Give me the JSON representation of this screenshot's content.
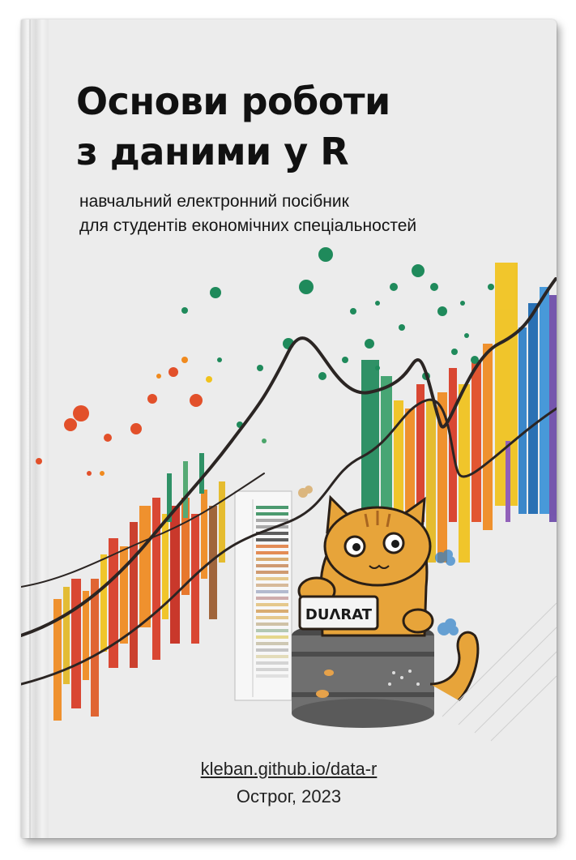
{
  "cover": {
    "title_line1": "Основи роботи",
    "title_line2": "з даними у R",
    "subtitle_line1": "навчальний електронний посібник",
    "subtitle_line2": "для студентів економічних спеціальностей",
    "url": "kleban.github.io/data-r",
    "place_year": "Острог, 2023",
    "label_text": "DUΛRAT"
  },
  "colors": {
    "background": "#ececec",
    "title": "#111111",
    "cat": "#e7a43a",
    "green": "#1f8a5b",
    "red": "#d83a24",
    "orange": "#f08a1e",
    "yellow": "#f1c21b",
    "blue": "#2d7fc8",
    "barrel": "#6b6b6b"
  },
  "icons": [
    "cat-illustration",
    "barrel-illustration",
    "data-spreadsheet-illustration",
    "cloud-icon"
  ]
}
